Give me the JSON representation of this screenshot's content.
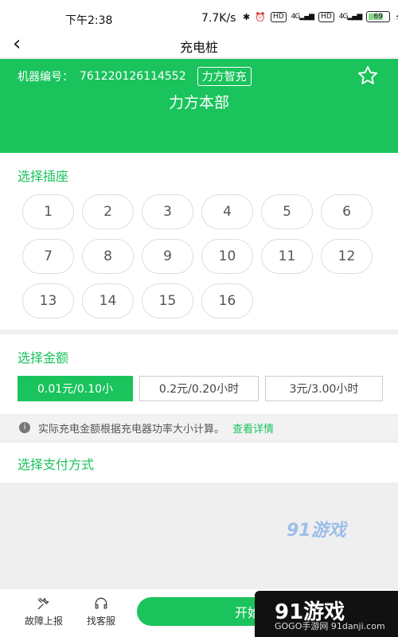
{
  "status_bar": {
    "time": "下午2:38",
    "network_speed": "7.7K/s",
    "hd_label": "HD",
    "signal_label": "4G",
    "battery": "69"
  },
  "nav": {
    "title": "充电桩"
  },
  "banner": {
    "machine_label": "机器编号：",
    "machine_number": "761220126114552",
    "brand_tag": "力方智充",
    "station_name": "力方本部"
  },
  "socket_section": {
    "title": "选择插座",
    "sockets": [
      "1",
      "2",
      "3",
      "4",
      "5",
      "6",
      "7",
      "8",
      "9",
      "10",
      "11",
      "12",
      "13",
      "14",
      "15",
      "16"
    ]
  },
  "amount_section": {
    "title": "选择金额",
    "options": [
      {
        "label": "0.01元/0.10小",
        "selected": true
      },
      {
        "label": "0.2元/0.20小时",
        "selected": false
      },
      {
        "label": "3元/3.00小时",
        "selected": false
      }
    ]
  },
  "notice": {
    "text": "实际充电金额根据充电器功率大小计算。",
    "link": "查看详情"
  },
  "payment_section": {
    "title": "选择支付方式"
  },
  "bottom_bar": {
    "report_label": "故障上报",
    "service_label": "找客服",
    "start_label": "开始充电"
  },
  "watermark": {
    "text": "91游戏",
    "sub": "GOGO手游网 91danji.com"
  },
  "colors": {
    "accent": "#1ac35c"
  }
}
